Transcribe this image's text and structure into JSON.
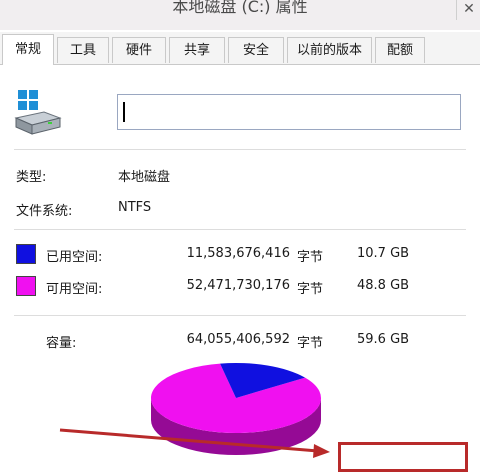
{
  "window": {
    "title": "本地磁盘 (C:) 属性",
    "close_glyph": "✕"
  },
  "tabs": [
    {
      "label": "常规",
      "active": true
    },
    {
      "label": "工具"
    },
    {
      "label": "硬件"
    },
    {
      "label": "共享"
    },
    {
      "label": "安全"
    },
    {
      "label": "以前的版本"
    },
    {
      "label": "配额"
    }
  ],
  "general": {
    "drive_name_value": "",
    "type_label": "类型:",
    "type_value": "本地磁盘",
    "fs_label": "文件系统:",
    "fs_value": "NTFS",
    "used": {
      "label": "已用空间:",
      "bytes": "11,583,676,416",
      "unit": "字节",
      "size": "10.7 GB",
      "color": "#1010e0"
    },
    "free": {
      "label": "可用空间:",
      "bytes": "52,471,730,176",
      "unit": "字节",
      "size": "48.8 GB",
      "color": "#f010f0"
    },
    "capacity": {
      "label": "容量:",
      "bytes": "64,055,406,592",
      "unit": "字节",
      "size": "59.6 GB"
    }
  },
  "pie": {
    "used_fraction": 0.181,
    "free_fraction": 0.819
  },
  "annotation": {
    "color": "#b82a2a"
  }
}
